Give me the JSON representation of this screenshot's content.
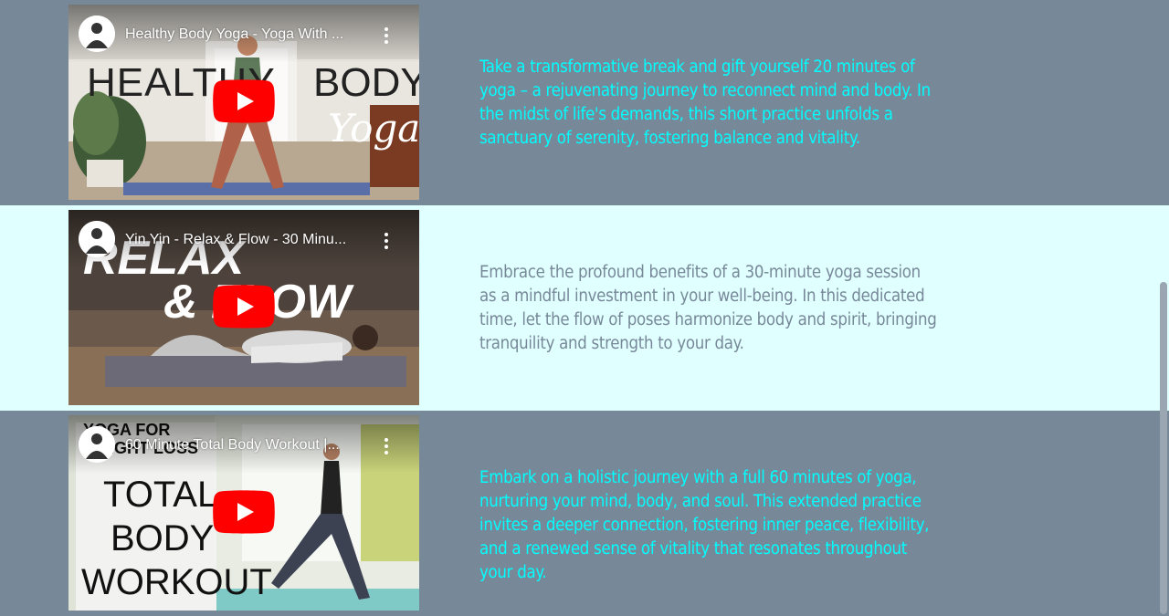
{
  "videos": [
    {
      "title": "Healthy Body Yoga - Yoga With ...",
      "description": "Take a transformative break and gift yourself 20 minutes of yoga – a rejuvenating journey to reconnect mind and body. In the midst of life's demands, this short practice unfolds a sanctuary of serenity, fostering balance and vitality.",
      "thumbnail_text": [
        "HEALTHY",
        "BODY",
        "Yoga"
      ]
    },
    {
      "title": "Yin Yin - Relax & Flow - 30 Minu...",
      "description": "Embrace the profound benefits of a 30-minute yoga session as a mindful investment in your well-being. In this dedicated time, let the flow of poses harmonize body and spirit, bringing tranquility and strength to your day.",
      "thumbnail_text": [
        "RELAX",
        "& FLOW"
      ]
    },
    {
      "title": "60 Minute Total Body Workout |...",
      "description": "Embark on a holistic journey with a full 60 minutes of yoga, nurturing your mind, body, and soul. This extended practice invites a deeper connection, fostering inner peace, flexibility, and a renewed sense of vitality that resonates throughout your day.",
      "thumbnail_text": [
        "YOGA FOR",
        "WEIGHT LOSS",
        "TOTAL",
        "BODY",
        "WORKOUT"
      ]
    }
  ],
  "colors": {
    "dark_row": "#778899",
    "light_row": "#e0ffff",
    "accent_text": "#00ffff",
    "muted_text": "#778899",
    "youtube_red": "#ff0000"
  },
  "icons": [
    "channel-avatar",
    "more-vert-icon",
    "youtube-play-icon"
  ]
}
